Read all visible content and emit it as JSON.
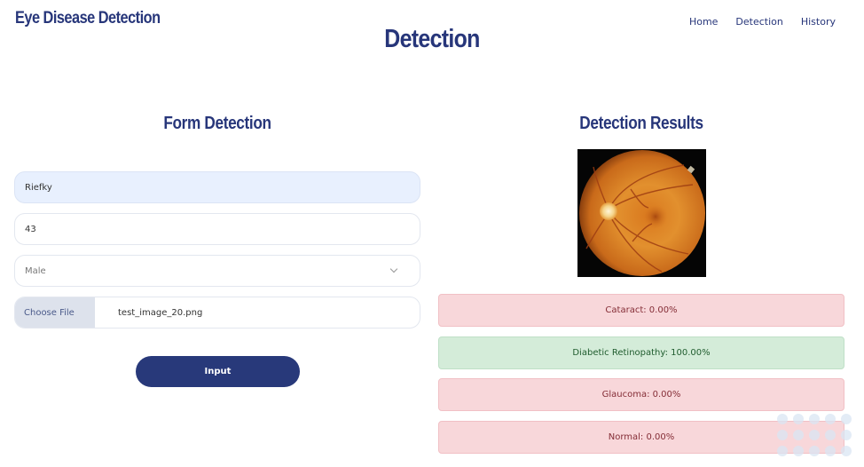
{
  "header": {
    "brand": "Eye Disease Detection",
    "nav": [
      "Home",
      "Detection",
      "History"
    ]
  },
  "page_title": "Detection",
  "form": {
    "title": "Form Detection",
    "name_value": "Riefky",
    "age_value": "43",
    "gender_value": "Male",
    "file_button_label": "Choose File",
    "file_name": "test_image_20.png",
    "submit_label": "Input"
  },
  "results": {
    "title": "Detection Results",
    "items": [
      {
        "label": "Cataract: 0.00%",
        "status": "negative"
      },
      {
        "label": "Diabetic Retinopathy: 100.00%",
        "status": "positive"
      },
      {
        "label": "Glaucoma: 0.00%",
        "status": "negative"
      },
      {
        "label": "Normal: 0.00%",
        "status": "negative"
      }
    ]
  },
  "colors": {
    "brand": "#27367a",
    "button": "#28397a",
    "negative_bg": "#f8d7da",
    "positive_bg": "#d4ecd9"
  }
}
